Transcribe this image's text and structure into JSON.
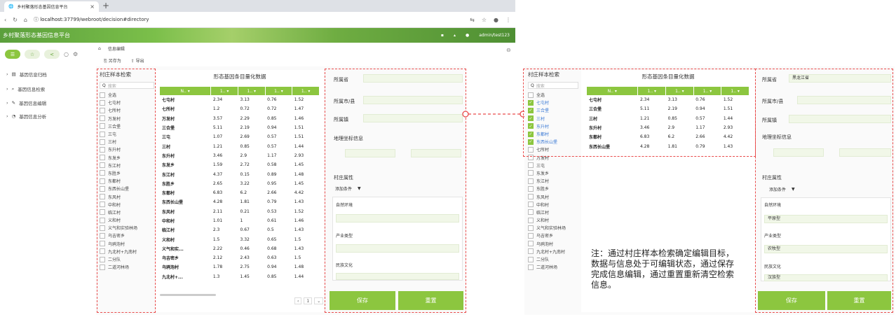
{
  "browser": {
    "tab_title": "乡村聚落形态基因信息平台",
    "url_host": "localhost",
    "url_path": ":37799/webroot/decision#directory"
  },
  "app": {
    "title": "乡村聚落形态基因信息平台",
    "user": "admin/test123"
  },
  "nav": {
    "items": [
      {
        "label": "基因信息归档"
      },
      {
        "label": "基因信息检索"
      },
      {
        "label": "基因信息编辑"
      },
      {
        "label": "基因信息分析"
      }
    ]
  },
  "breadcrumb": {
    "tab": "信息编辑"
  },
  "toolbar": {
    "save_as": "另存为",
    "export": "导出"
  },
  "village_search": {
    "title": "村庄样本检索",
    "search_placeholder": "搜索",
    "items": [
      "全选",
      "七屯村",
      "七所村",
      "万发村",
      "三合堡",
      "三屯",
      "三村",
      "东升村",
      "东发乡",
      "东江村",
      "东胜乡",
      "东都村",
      "东西长山堡",
      "东风村",
      "中和村",
      "临江村",
      "义和村",
      "义气和实验林场",
      "乌吉密乡",
      "乌鸦泡村",
      "九北村+九南村",
      "二分队",
      "二道河林场"
    ]
  },
  "data_table": {
    "title": "形态基因条目量化数据",
    "headers": [
      "N..",
      "1..",
      "1..",
      "1..",
      "1.."
    ],
    "rows": [
      [
        "七屯村",
        "2.34",
        "3.13",
        "0.76",
        "1.52"
      ],
      [
        "七所村",
        "1.2",
        "0.72",
        "0.72",
        "1.47"
      ],
      [
        "万发村",
        "3.57",
        "2.29",
        "0.85",
        "1.46"
      ],
      [
        "三合堡",
        "5.11",
        "2.19",
        "0.94",
        "1.51"
      ],
      [
        "三屯",
        "1.07",
        "2.69",
        "0.57",
        "1.51"
      ],
      [
        "三村",
        "1.21",
        "0.85",
        "0.57",
        "1.44"
      ],
      [
        "东升村",
        "3.46",
        "2.9",
        "1.17",
        "2.93"
      ],
      [
        "东发乡",
        "1.59",
        "2.72",
        "0.58",
        "1.45"
      ],
      [
        "东江村",
        "4.37",
        "0.15",
        "0.89",
        "1.48"
      ],
      [
        "东胜乡",
        "2.65",
        "3.22",
        "0.95",
        "1.45"
      ],
      [
        "东都村",
        "6.83",
        "6.2",
        "2.66",
        "4.42"
      ],
      [
        "东西长山堡",
        "4.28",
        "1.81",
        "0.79",
        "1.43"
      ],
      [
        "东风村",
        "2.11",
        "0.21",
        "0.53",
        "1.52"
      ],
      [
        "中和村",
        "1.01",
        "1",
        "0.61",
        "1.46"
      ],
      [
        "临江村",
        "2.3",
        "0.67",
        "0.5",
        "1.43"
      ],
      [
        "义和村",
        "1.5",
        "3.32",
        "0.65",
        "1.5"
      ],
      [
        "义气和实...",
        "2.22",
        "0.46",
        "0.68",
        "1.43"
      ],
      [
        "乌吉密乡",
        "2.12",
        "2.43",
        "0.63",
        "1.5"
      ],
      [
        "乌鸦泡村",
        "1.78",
        "2.75",
        "0.94",
        "1.48"
      ],
      [
        "九北村+...",
        "1.3",
        "1.45",
        "0.85",
        "1.44"
      ]
    ],
    "page": "1"
  },
  "form": {
    "province_label": "所属省",
    "city_label": "所属市/县",
    "town_label": "所属镇",
    "geo_label": "地理坐标信息",
    "attr_label": "村庄属性",
    "add_condition": "添加条件",
    "env_label": "自然环境",
    "industry_label": "产业类型",
    "culture_label": "民族文化",
    "save": "保存",
    "reset": "重置"
  },
  "right": {
    "search_items": [
      {
        "label": "全选",
        "checked": false
      },
      {
        "label": "七屯村",
        "checked": true
      },
      {
        "label": "三合堡",
        "checked": true
      },
      {
        "label": "三村",
        "checked": true
      },
      {
        "label": "东升村",
        "checked": true
      },
      {
        "label": "东都村",
        "checked": true
      },
      {
        "label": "东西长山堡",
        "checked": true
      },
      {
        "label": "七所村",
        "checked": false
      },
      {
        "label": "万发村",
        "checked": false
      },
      {
        "label": "三屯",
        "checked": false
      },
      {
        "label": "东发乡",
        "checked": false
      },
      {
        "label": "东江村",
        "checked": false
      },
      {
        "label": "东胜乡",
        "checked": false
      },
      {
        "label": "东风村",
        "checked": false
      },
      {
        "label": "中和村",
        "checked": false
      },
      {
        "label": "临江村",
        "checked": false
      },
      {
        "label": "义和村",
        "checked": false
      },
      {
        "label": "义气和实验林场",
        "checked": false
      },
      {
        "label": "乌吉密乡",
        "checked": false
      },
      {
        "label": "乌鸦泡村",
        "checked": false
      },
      {
        "label": "九北村+九南村",
        "checked": false
      },
      {
        "label": "二分队",
        "checked": false
      },
      {
        "label": "二道河林场",
        "checked": false
      }
    ],
    "rows": [
      [
        "七屯村",
        "2.34",
        "3.13",
        "0.76",
        "1.52"
      ],
      [
        "三合堡",
        "5.11",
        "2.19",
        "0.94",
        "1.51"
      ],
      [
        "三村",
        "1.21",
        "0.85",
        "0.57",
        "1.44"
      ],
      [
        "东升村",
        "3.46",
        "2.9",
        "1.17",
        "2.93"
      ],
      [
        "东都村",
        "6.83",
        "6.2",
        "2.66",
        "4.42"
      ],
      [
        "东西长山堡",
        "4.28",
        "1.81",
        "0.79",
        "1.43"
      ]
    ],
    "province_value": "黑龙江省",
    "env_value": "平原型",
    "industry_value": "农牧型",
    "culture_value": "汉族型",
    "note": "注：通过村庄样本检索确定编辑目标，数据与信息处于可编辑状态，通过保存完成信息编辑，通过重置重新清空检索信息。"
  }
}
